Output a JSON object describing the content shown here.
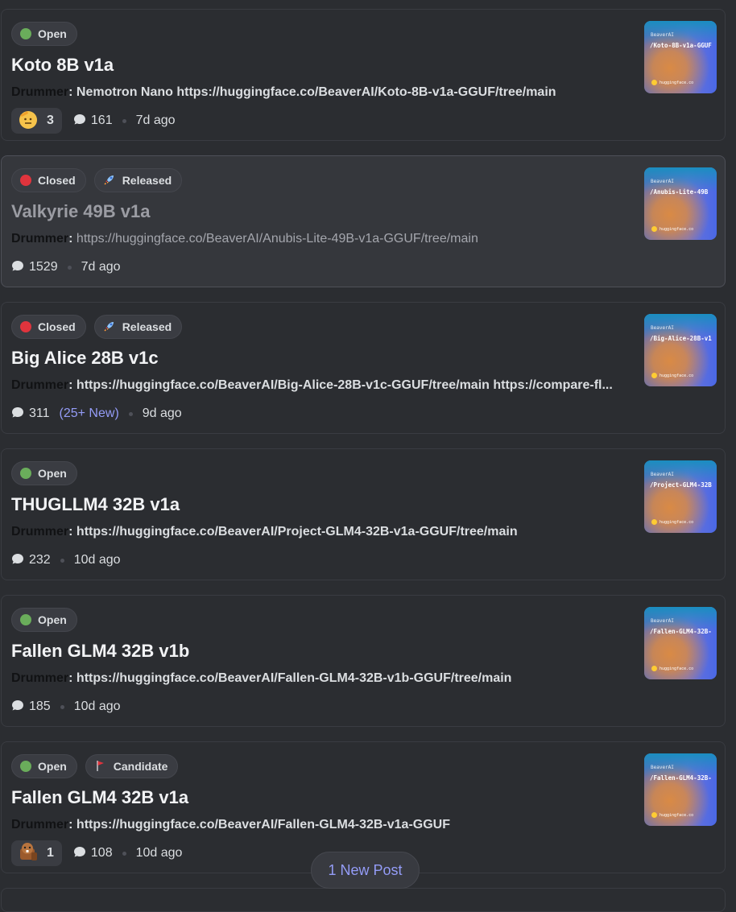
{
  "posts": [
    {
      "tags": [
        {
          "label": "Open",
          "kind": "open"
        }
      ],
      "title": "Koto 8B v1a",
      "author": "Drummer",
      "body": "Nemotron Nano https://huggingface.co/BeaverAI/Koto-8B-v1a-GGUF/tree/main",
      "reaction": {
        "emoji": "saluting-face-icon",
        "count": "3"
      },
      "replies": "161",
      "new_replies": "",
      "age": "7d ago",
      "thumb": {
        "brand": "BeaverAI",
        "path": "/Koto-8B-v1a-GGUF",
        "footer": "huggingface.co"
      }
    },
    {
      "tags": [
        {
          "label": "Closed",
          "kind": "closed"
        },
        {
          "label": "Released",
          "kind": "rocket"
        }
      ],
      "title": "Valkyrie 49B v1a",
      "author": "Drummer",
      "body": "https://huggingface.co/BeaverAI/Anubis-Lite-49B-v1a-GGUF/tree/main",
      "reaction": null,
      "replies": "1529",
      "new_replies": "",
      "age": "7d ago",
      "thumb": {
        "brand": "BeaverAI",
        "path": "/Anubis-Lite-49B",
        "footer": "huggingface.co"
      }
    },
    {
      "tags": [
        {
          "label": "Closed",
          "kind": "closed"
        },
        {
          "label": "Released",
          "kind": "rocket"
        }
      ],
      "title": "Big Alice 28B v1c",
      "author": "Drummer",
      "body": "https://huggingface.co/BeaverAI/Big-Alice-28B-v1c-GGUF/tree/main https://compare-fl...",
      "reaction": null,
      "replies": "311",
      "new_replies": "(25+ New)",
      "age": "9d ago",
      "thumb": {
        "brand": "BeaverAI",
        "path": "/Big-Alice-28B-v1",
        "footer": "huggingface.co"
      }
    },
    {
      "tags": [
        {
          "label": "Open",
          "kind": "open"
        }
      ],
      "title": "THUGLLM4 32B v1a",
      "author": "Drummer",
      "body": "https://huggingface.co/BeaverAI/Project-GLM4-32B-v1a-GGUF/tree/main",
      "reaction": null,
      "replies": "232",
      "new_replies": "",
      "age": "10d ago",
      "thumb": {
        "brand": "BeaverAI",
        "path": "/Project-GLM4-32B",
        "footer": "huggingface.co"
      }
    },
    {
      "tags": [
        {
          "label": "Open",
          "kind": "open"
        }
      ],
      "title": "Fallen GLM4 32B v1b",
      "author": "Drummer",
      "body": "https://huggingface.co/BeaverAI/Fallen-GLM4-32B-v1b-GGUF/tree/main",
      "reaction": null,
      "replies": "185",
      "new_replies": "",
      "age": "10d ago",
      "thumb": {
        "brand": "BeaverAI",
        "path": "/Fallen-GLM4-32B-",
        "footer": "huggingface.co"
      }
    },
    {
      "tags": [
        {
          "label": "Open",
          "kind": "open"
        },
        {
          "label": "Candidate",
          "kind": "flag"
        }
      ],
      "title": "Fallen GLM4 32B v1a",
      "author": "Drummer",
      "body": "https://huggingface.co/BeaverAI/Fallen-GLM4-32B-v1a-GGUF",
      "reaction": {
        "emoji": "beaver-icon",
        "count": "1"
      },
      "replies": "108",
      "new_replies": "",
      "age": "10d ago",
      "thumb": {
        "brand": "BeaverAI",
        "path": "/Fallen-GLM4-32B-",
        "footer": "huggingface.co"
      }
    }
  ],
  "new_posts_label": "1 New Post",
  "colors": {
    "open": "#6aad5b",
    "closed": "#e0343d",
    "accent": "#949cf7"
  }
}
